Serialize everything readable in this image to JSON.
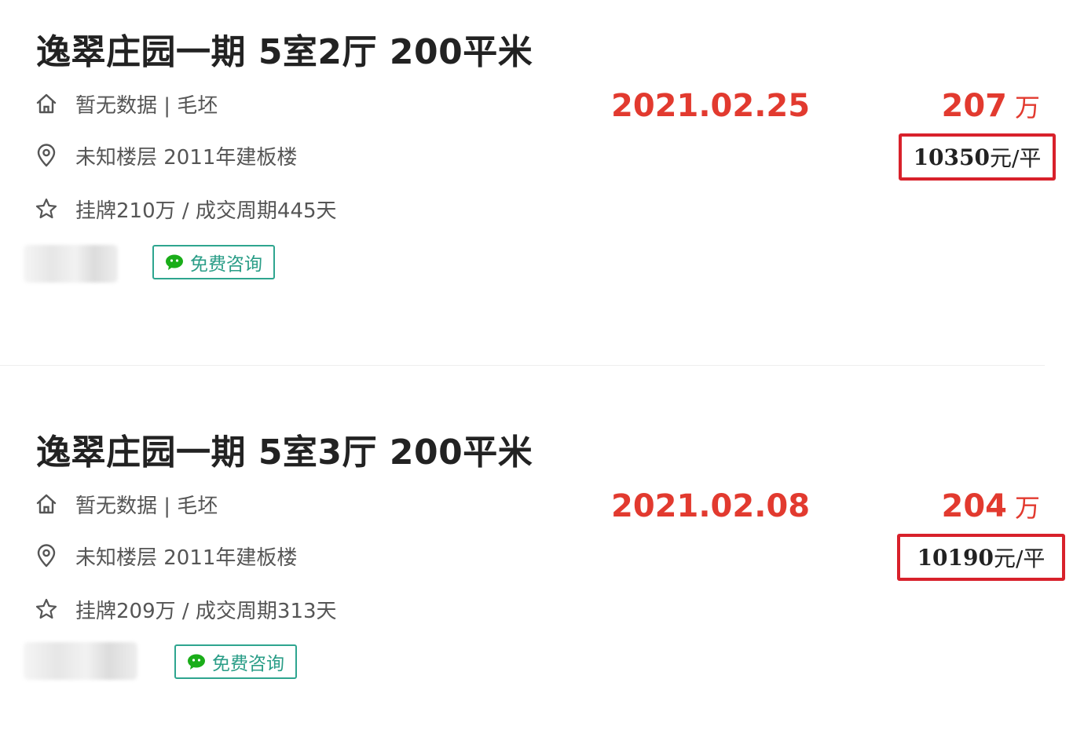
{
  "listings": [
    {
      "title": "逸翠庄园一期 5室2厅 200平米",
      "orientation_decor": "暂无数据 | 毛坯",
      "floor_year": "未知楼层 2011年建板楼",
      "listing_cycle": "挂牌210万 / 成交周期445天",
      "deal_date": "2021.02.25",
      "total_price": "207",
      "total_price_unit": "万",
      "unit_price": "10350",
      "unit_price_suffix": "元/平",
      "consult_label": "免费咨询"
    },
    {
      "title": "逸翠庄园一期 5室3厅 200平米",
      "orientation_decor": "暂无数据 | 毛坯",
      "floor_year": "未知楼层 2011年建板楼",
      "listing_cycle": "挂牌209万 / 成交周期313天",
      "deal_date": "2021.02.08",
      "total_price": "204",
      "total_price_unit": "万",
      "unit_price": "10190",
      "unit_price_suffix": "元/平",
      "consult_label": "免费咨询"
    }
  ],
  "icons": {
    "house": "house-icon",
    "location": "location-pin-icon",
    "star": "star-icon",
    "chat": "wechat-icon"
  },
  "colors": {
    "accent_red": "#e23a2f",
    "highlight_box": "#d8212b",
    "consult_green": "#2ea58f"
  }
}
